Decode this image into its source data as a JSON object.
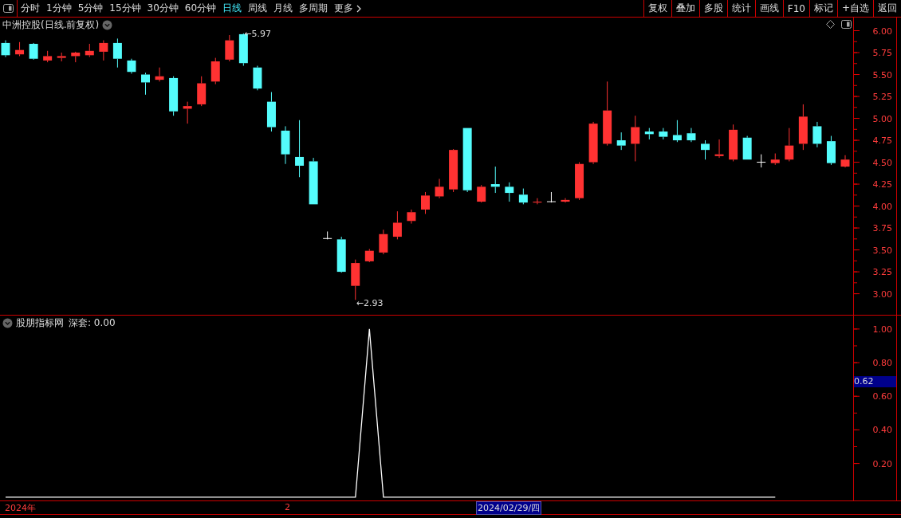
{
  "toolbar": {
    "periods": [
      {
        "label": "分时",
        "selected": false
      },
      {
        "label": "1分钟",
        "selected": false
      },
      {
        "label": "5分钟",
        "selected": false
      },
      {
        "label": "15分钟",
        "selected": false
      },
      {
        "label": "30分钟",
        "selected": false
      },
      {
        "label": "60分钟",
        "selected": false
      },
      {
        "label": "日线",
        "selected": true
      },
      {
        "label": "周线",
        "selected": false
      },
      {
        "label": "月线",
        "selected": false
      },
      {
        "label": "多周期",
        "selected": false
      }
    ],
    "more": "更多",
    "buttons": [
      "复权",
      "叠加",
      "多股",
      "统计",
      "画线",
      "F10",
      "标记",
      "+自选",
      "返回"
    ]
  },
  "price_pane": {
    "title": "中洲控股(日线.前复权)",
    "chart_data": {
      "type": "candlestick",
      "ylim": [
        2.76,
        6.15
      ],
      "yticks": [
        {
          "value": 6,
          "label": "6.00"
        },
        {
          "value": 5.75,
          "label": "5.75"
        },
        {
          "value": 5.5,
          "label": "5.50"
        },
        {
          "value": 5.25,
          "label": "5.25"
        },
        {
          "value": 5,
          "label": "5.00"
        },
        {
          "value": 4.75,
          "label": "4.75"
        },
        {
          "value": 4.5,
          "label": "4.50"
        },
        {
          "value": 4.25,
          "label": "4.25"
        },
        {
          "value": 4,
          "label": "4.00"
        },
        {
          "value": 3.75,
          "label": "3.75"
        },
        {
          "value": 3.5,
          "label": "3.50"
        },
        {
          "value": 3.25,
          "label": "3.25"
        },
        {
          "value": 3,
          "label": "3.00"
        }
      ],
      "categories": [
        null,
        null,
        null,
        null,
        null,
        null,
        null,
        null,
        null,
        null,
        null,
        null,
        null,
        null,
        null,
        null,
        null,
        null,
        null,
        null,
        null,
        null,
        null,
        null,
        null,
        null,
        null,
        null,
        null,
        null,
        null,
        null,
        null,
        null,
        null,
        null,
        null,
        null,
        null,
        null,
        null,
        null,
        null,
        null,
        null,
        null,
        null,
        null,
        null,
        null,
        null,
        null,
        null,
        null,
        null,
        null,
        null,
        null,
        null,
        null,
        null
      ],
      "ohlc": [
        [
          5.86,
          5.89,
          5.7,
          5.72
        ],
        [
          5.73,
          5.87,
          5.71,
          5.78
        ],
        [
          5.85,
          5.86,
          5.67,
          5.68
        ],
        [
          5.66,
          5.77,
          5.64,
          5.71
        ],
        [
          5.69,
          5.75,
          5.65,
          5.71
        ],
        [
          5.71,
          5.76,
          5.64,
          5.75
        ],
        [
          5.72,
          5.85,
          5.7,
          5.77
        ],
        [
          5.76,
          5.89,
          5.66,
          5.86
        ],
        [
          5.86,
          5.91,
          5.58,
          5.68
        ],
        [
          5.66,
          5.68,
          5.51,
          5.53
        ],
        [
          5.5,
          5.52,
          5.27,
          5.41
        ],
        [
          5.44,
          5.58,
          5.42,
          5.48
        ],
        [
          5.46,
          5.48,
          5.03,
          5.08
        ],
        [
          5.11,
          5.19,
          4.94,
          5.14
        ],
        [
          5.16,
          5.48,
          5.14,
          5.4
        ],
        [
          5.42,
          5.69,
          5.39,
          5.65
        ],
        [
          5.67,
          5.95,
          5.65,
          5.89
        ],
        [
          5.96,
          5.97,
          5.6,
          5.63
        ],
        [
          5.58,
          5.6,
          5.32,
          5.34
        ],
        [
          5.19,
          5.3,
          4.85,
          4.9
        ],
        [
          4.86,
          4.91,
          4.48,
          4.59
        ],
        [
          4.56,
          4.98,
          4.33,
          4.46
        ],
        [
          4.51,
          4.55,
          4.02,
          4.02
        ],
        [
          3.63,
          3.71,
          3.62,
          3.63
        ],
        [
          3.62,
          3.65,
          3.24,
          3.25
        ],
        [
          3.09,
          3.39,
          2.93,
          3.35
        ],
        [
          3.37,
          3.51,
          3.36,
          3.49
        ],
        [
          3.47,
          3.73,
          3.45,
          3.68
        ],
        [
          3.65,
          3.94,
          3.62,
          3.81
        ],
        [
          3.83,
          3.96,
          3.8,
          3.93
        ],
        [
          3.96,
          4.16,
          3.91,
          4.12
        ],
        [
          4.11,
          4.31,
          4.09,
          4.22
        ],
        [
          4.19,
          4.65,
          4.16,
          4.64
        ],
        [
          4.89,
          4.89,
          4.16,
          4.18
        ],
        [
          4.05,
          4.24,
          4.04,
          4.22
        ],
        [
          4.25,
          4.45,
          4.15,
          4.22
        ],
        [
          4.22,
          4.27,
          4.05,
          4.15
        ],
        [
          4.13,
          4.2,
          4.02,
          4.04
        ],
        [
          4.04,
          4.09,
          4.02,
          4.05
        ],
        [
          4.05,
          4.16,
          4.04,
          4.05
        ],
        [
          4.05,
          4.09,
          4.04,
          4.07
        ],
        [
          4.09,
          4.5,
          4.07,
          4.48
        ],
        [
          4.5,
          4.96,
          4.48,
          4.94
        ],
        [
          4.71,
          5.42,
          4.69,
          5.09
        ],
        [
          4.75,
          4.84,
          4.64,
          4.69
        ],
        [
          4.71,
          5.03,
          4.51,
          4.9
        ],
        [
          4.85,
          4.89,
          4.76,
          4.82
        ],
        [
          4.85,
          4.89,
          4.76,
          4.79
        ],
        [
          4.81,
          4.98,
          4.73,
          4.75
        ],
        [
          4.83,
          4.89,
          4.73,
          4.75
        ],
        [
          4.71,
          4.75,
          4.53,
          4.64
        ],
        [
          4.57,
          4.76,
          4.55,
          4.59
        ],
        [
          4.53,
          4.93,
          4.51,
          4.87
        ],
        [
          4.78,
          4.8,
          4.53,
          4.53
        ],
        [
          4.5,
          4.59,
          4.44,
          4.5
        ],
        [
          4.49,
          4.6,
          4.47,
          4.53
        ],
        [
          4.53,
          4.89,
          4.51,
          4.69
        ],
        [
          4.71,
          5.16,
          4.64,
          5.02
        ],
        [
          4.91,
          4.96,
          4.67,
          4.71
        ],
        [
          4.74,
          4.8,
          4.47,
          4.49
        ],
        [
          4.45,
          4.58,
          4.44,
          4.53
        ]
      ],
      "annotations": [
        "←5.97",
        "←2.93"
      ]
    }
  },
  "indicator_pane": {
    "name": "股朋指标网",
    "reading": "深套: 0.00",
    "chart_data": {
      "type": "line",
      "ylim": [
        -0.02,
        1.08
      ],
      "yticks": [
        {
          "value": 1,
          "label": "1.00"
        },
        {
          "value": 0.8,
          "label": "0.80"
        },
        {
          "value": 0.6,
          "label": "0.60"
        },
        {
          "value": 0.4,
          "label": "0.40"
        },
        {
          "value": 0.2,
          "label": "0.20"
        }
      ],
      "categories": [
        null,
        null,
        null,
        null,
        null,
        null,
        null,
        null,
        null,
        null,
        null,
        null,
        null,
        null,
        null,
        null,
        null,
        null,
        null,
        null,
        null,
        null,
        null,
        null,
        null,
        null,
        null,
        null,
        null,
        null,
        null,
        null,
        null,
        null,
        null,
        null,
        null,
        null,
        null,
        null,
        null,
        null,
        null,
        null,
        null,
        null,
        null,
        null,
        null,
        null,
        null,
        null,
        null,
        null,
        null,
        null
      ],
      "series": [
        {
          "color": "#ffffff",
          "values": [
            0,
            0,
            0,
            0,
            0,
            0,
            0,
            0,
            0,
            0,
            0,
            0,
            0,
            0,
            0,
            0,
            0,
            0,
            0,
            0,
            0,
            0,
            0,
            0,
            0,
            0,
            1,
            0,
            0,
            0,
            0,
            0,
            0,
            0,
            0,
            0,
            0,
            0,
            0,
            0,
            0,
            0,
            0,
            0,
            0,
            0,
            0,
            0,
            0,
            0,
            0,
            0,
            0,
            0,
            0,
            0
          ]
        }
      ]
    },
    "cursor_value": "0.62"
  },
  "time_axis": {
    "labels": [
      "2024年",
      "2"
    ],
    "cursor_date": "2024/02/29/四"
  }
}
